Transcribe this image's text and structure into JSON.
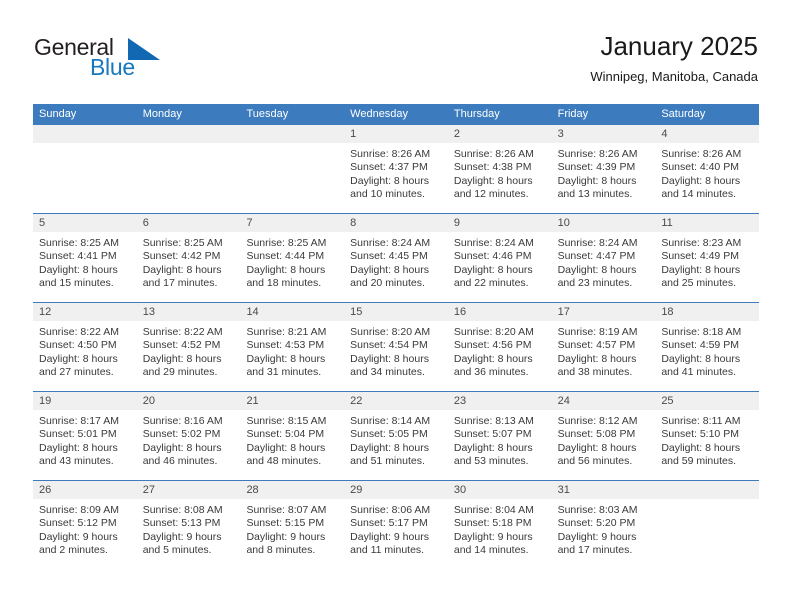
{
  "brand": {
    "name_part1": "General",
    "name_part2": "Blue",
    "accent_color": "#1268b3"
  },
  "header": {
    "title": "January 2025",
    "subtitle": "Winnipeg, Manitoba, Canada"
  },
  "theme": {
    "header_blue": "#3c7cbe",
    "day_number_bg": "#f0f0f0"
  },
  "weekdays": [
    "Sunday",
    "Monday",
    "Tuesday",
    "Wednesday",
    "Thursday",
    "Friday",
    "Saturday"
  ],
  "weeks": [
    {
      "days": [
        {
          "num": "",
          "lines": [],
          "empty": true
        },
        {
          "num": "",
          "lines": [],
          "empty": true
        },
        {
          "num": "",
          "lines": [],
          "empty": true
        },
        {
          "num": "1",
          "lines": [
            "Sunrise: 8:26 AM",
            "Sunset: 4:37 PM",
            "Daylight: 8 hours",
            "and 10 minutes."
          ],
          "empty": false
        },
        {
          "num": "2",
          "lines": [
            "Sunrise: 8:26 AM",
            "Sunset: 4:38 PM",
            "Daylight: 8 hours",
            "and 12 minutes."
          ],
          "empty": false
        },
        {
          "num": "3",
          "lines": [
            "Sunrise: 8:26 AM",
            "Sunset: 4:39 PM",
            "Daylight: 8 hours",
            "and 13 minutes."
          ],
          "empty": false
        },
        {
          "num": "4",
          "lines": [
            "Sunrise: 8:26 AM",
            "Sunset: 4:40 PM",
            "Daylight: 8 hours",
            "and 14 minutes."
          ],
          "empty": false
        }
      ]
    },
    {
      "days": [
        {
          "num": "5",
          "lines": [
            "Sunrise: 8:25 AM",
            "Sunset: 4:41 PM",
            "Daylight: 8 hours",
            "and 15 minutes."
          ],
          "empty": false
        },
        {
          "num": "6",
          "lines": [
            "Sunrise: 8:25 AM",
            "Sunset: 4:42 PM",
            "Daylight: 8 hours",
            "and 17 minutes."
          ],
          "empty": false
        },
        {
          "num": "7",
          "lines": [
            "Sunrise: 8:25 AM",
            "Sunset: 4:44 PM",
            "Daylight: 8 hours",
            "and 18 minutes."
          ],
          "empty": false
        },
        {
          "num": "8",
          "lines": [
            "Sunrise: 8:24 AM",
            "Sunset: 4:45 PM",
            "Daylight: 8 hours",
            "and 20 minutes."
          ],
          "empty": false
        },
        {
          "num": "9",
          "lines": [
            "Sunrise: 8:24 AM",
            "Sunset: 4:46 PM",
            "Daylight: 8 hours",
            "and 22 minutes."
          ],
          "empty": false
        },
        {
          "num": "10",
          "lines": [
            "Sunrise: 8:24 AM",
            "Sunset: 4:47 PM",
            "Daylight: 8 hours",
            "and 23 minutes."
          ],
          "empty": false
        },
        {
          "num": "11",
          "lines": [
            "Sunrise: 8:23 AM",
            "Sunset: 4:49 PM",
            "Daylight: 8 hours",
            "and 25 minutes."
          ],
          "empty": false
        }
      ]
    },
    {
      "days": [
        {
          "num": "12",
          "lines": [
            "Sunrise: 8:22 AM",
            "Sunset: 4:50 PM",
            "Daylight: 8 hours",
            "and 27 minutes."
          ],
          "empty": false
        },
        {
          "num": "13",
          "lines": [
            "Sunrise: 8:22 AM",
            "Sunset: 4:52 PM",
            "Daylight: 8 hours",
            "and 29 minutes."
          ],
          "empty": false
        },
        {
          "num": "14",
          "lines": [
            "Sunrise: 8:21 AM",
            "Sunset: 4:53 PM",
            "Daylight: 8 hours",
            "and 31 minutes."
          ],
          "empty": false
        },
        {
          "num": "15",
          "lines": [
            "Sunrise: 8:20 AM",
            "Sunset: 4:54 PM",
            "Daylight: 8 hours",
            "and 34 minutes."
          ],
          "empty": false
        },
        {
          "num": "16",
          "lines": [
            "Sunrise: 8:20 AM",
            "Sunset: 4:56 PM",
            "Daylight: 8 hours",
            "and 36 minutes."
          ],
          "empty": false
        },
        {
          "num": "17",
          "lines": [
            "Sunrise: 8:19 AM",
            "Sunset: 4:57 PM",
            "Daylight: 8 hours",
            "and 38 minutes."
          ],
          "empty": false
        },
        {
          "num": "18",
          "lines": [
            "Sunrise: 8:18 AM",
            "Sunset: 4:59 PM",
            "Daylight: 8 hours",
            "and 41 minutes."
          ],
          "empty": false
        }
      ]
    },
    {
      "days": [
        {
          "num": "19",
          "lines": [
            "Sunrise: 8:17 AM",
            "Sunset: 5:01 PM",
            "Daylight: 8 hours",
            "and 43 minutes."
          ],
          "empty": false
        },
        {
          "num": "20",
          "lines": [
            "Sunrise: 8:16 AM",
            "Sunset: 5:02 PM",
            "Daylight: 8 hours",
            "and 46 minutes."
          ],
          "empty": false
        },
        {
          "num": "21",
          "lines": [
            "Sunrise: 8:15 AM",
            "Sunset: 5:04 PM",
            "Daylight: 8 hours",
            "and 48 minutes."
          ],
          "empty": false
        },
        {
          "num": "22",
          "lines": [
            "Sunrise: 8:14 AM",
            "Sunset: 5:05 PM",
            "Daylight: 8 hours",
            "and 51 minutes."
          ],
          "empty": false
        },
        {
          "num": "23",
          "lines": [
            "Sunrise: 8:13 AM",
            "Sunset: 5:07 PM",
            "Daylight: 8 hours",
            "and 53 minutes."
          ],
          "empty": false
        },
        {
          "num": "24",
          "lines": [
            "Sunrise: 8:12 AM",
            "Sunset: 5:08 PM",
            "Daylight: 8 hours",
            "and 56 minutes."
          ],
          "empty": false
        },
        {
          "num": "25",
          "lines": [
            "Sunrise: 8:11 AM",
            "Sunset: 5:10 PM",
            "Daylight: 8 hours",
            "and 59 minutes."
          ],
          "empty": false
        }
      ]
    },
    {
      "days": [
        {
          "num": "26",
          "lines": [
            "Sunrise: 8:09 AM",
            "Sunset: 5:12 PM",
            "Daylight: 9 hours",
            "and 2 minutes."
          ],
          "empty": false
        },
        {
          "num": "27",
          "lines": [
            "Sunrise: 8:08 AM",
            "Sunset: 5:13 PM",
            "Daylight: 9 hours",
            "and 5 minutes."
          ],
          "empty": false
        },
        {
          "num": "28",
          "lines": [
            "Sunrise: 8:07 AM",
            "Sunset: 5:15 PM",
            "Daylight: 9 hours",
            "and 8 minutes."
          ],
          "empty": false
        },
        {
          "num": "29",
          "lines": [
            "Sunrise: 8:06 AM",
            "Sunset: 5:17 PM",
            "Daylight: 9 hours",
            "and 11 minutes."
          ],
          "empty": false
        },
        {
          "num": "30",
          "lines": [
            "Sunrise: 8:04 AM",
            "Sunset: 5:18 PM",
            "Daylight: 9 hours",
            "and 14 minutes."
          ],
          "empty": false
        },
        {
          "num": "31",
          "lines": [
            "Sunrise: 8:03 AM",
            "Sunset: 5:20 PM",
            "Daylight: 9 hours",
            "and 17 minutes."
          ],
          "empty": false
        },
        {
          "num": "",
          "lines": [],
          "empty": true
        }
      ]
    }
  ]
}
